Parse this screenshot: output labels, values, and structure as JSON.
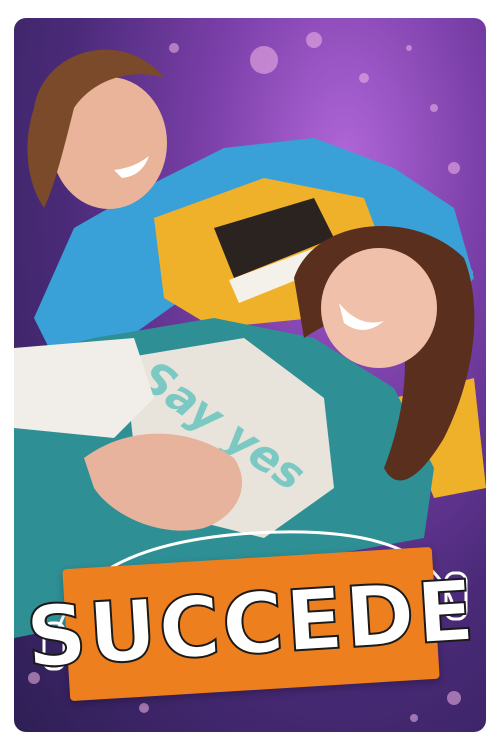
{
  "poster": {
    "title": "SUCCEDE",
    "shirt_print": "Say yes",
    "colors": {
      "background_purple": "#7a3fa8",
      "title_orange": "#ee7f1f",
      "jacket_blue": "#3aa0d8",
      "sweater_teal": "#2e8f95",
      "shirt_yellow": "#f0b12a"
    }
  }
}
